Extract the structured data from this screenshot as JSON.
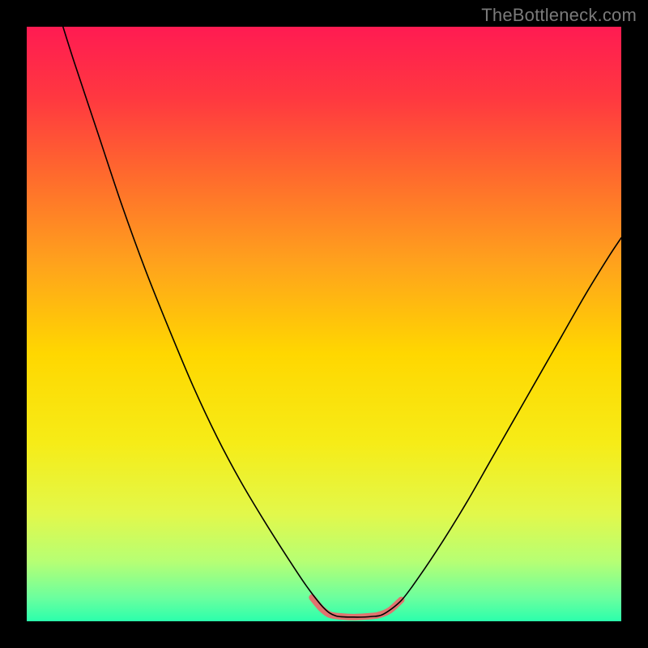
{
  "attribution": "TheBottleneck.com",
  "chart_data": {
    "type": "line",
    "title": "",
    "xlabel": "",
    "ylabel": "",
    "xlim": [
      0,
      100
    ],
    "ylim": [
      0,
      100
    ],
    "background_gradient": {
      "stops": [
        {
          "offset": 0.0,
          "color": "#ff1b52"
        },
        {
          "offset": 0.12,
          "color": "#ff3840"
        },
        {
          "offset": 0.25,
          "color": "#ff6a2d"
        },
        {
          "offset": 0.4,
          "color": "#ffa31c"
        },
        {
          "offset": 0.55,
          "color": "#ffd700"
        },
        {
          "offset": 0.7,
          "color": "#f6ec17"
        },
        {
          "offset": 0.82,
          "color": "#e2f84b"
        },
        {
          "offset": 0.9,
          "color": "#b6ff74"
        },
        {
          "offset": 0.96,
          "color": "#6cff9e"
        },
        {
          "offset": 1.0,
          "color": "#2bffac"
        }
      ]
    },
    "series": [
      {
        "name": "bottleneck-curve",
        "color": "#000000",
        "stroke_width": 1.6,
        "points": [
          {
            "x": 6.1,
            "y": 100.0
          },
          {
            "x": 8.0,
            "y": 94.0
          },
          {
            "x": 12.0,
            "y": 82.0
          },
          {
            "x": 16.0,
            "y": 70.0
          },
          {
            "x": 20.0,
            "y": 59.0
          },
          {
            "x": 24.0,
            "y": 49.0
          },
          {
            "x": 28.0,
            "y": 39.5
          },
          {
            "x": 32.0,
            "y": 31.0
          },
          {
            "x": 36.0,
            "y": 23.5
          },
          {
            "x": 40.0,
            "y": 16.8
          },
          {
            "x": 44.0,
            "y": 10.5
          },
          {
            "x": 47.0,
            "y": 6.0
          },
          {
            "x": 50.0,
            "y": 2.2
          },
          {
            "x": 52.0,
            "y": 0.9
          },
          {
            "x": 55.0,
            "y": 0.7
          },
          {
            "x": 58.0,
            "y": 0.8
          },
          {
            "x": 60.0,
            "y": 1.2
          },
          {
            "x": 63.0,
            "y": 3.5
          },
          {
            "x": 66.0,
            "y": 7.5
          },
          {
            "x": 70.0,
            "y": 13.5
          },
          {
            "x": 74.0,
            "y": 20.0
          },
          {
            "x": 78.0,
            "y": 27.0
          },
          {
            "x": 82.0,
            "y": 34.0
          },
          {
            "x": 86.0,
            "y": 41.0
          },
          {
            "x": 90.0,
            "y": 48.0
          },
          {
            "x": 94.0,
            "y": 55.0
          },
          {
            "x": 98.0,
            "y": 61.5
          },
          {
            "x": 100.0,
            "y": 64.5
          }
        ]
      },
      {
        "name": "optimal-zone-highlight",
        "color": "#e0736f",
        "stroke_width": 8,
        "points": [
          {
            "x": 48.0,
            "y": 4.0
          },
          {
            "x": 49.5,
            "y": 2.2
          },
          {
            "x": 51.0,
            "y": 1.1
          },
          {
            "x": 53.0,
            "y": 0.8
          },
          {
            "x": 55.0,
            "y": 0.7
          },
          {
            "x": 57.0,
            "y": 0.8
          },
          {
            "x": 59.0,
            "y": 1.0
          },
          {
            "x": 61.0,
            "y": 1.8
          },
          {
            "x": 63.0,
            "y": 3.6
          }
        ]
      }
    ]
  }
}
